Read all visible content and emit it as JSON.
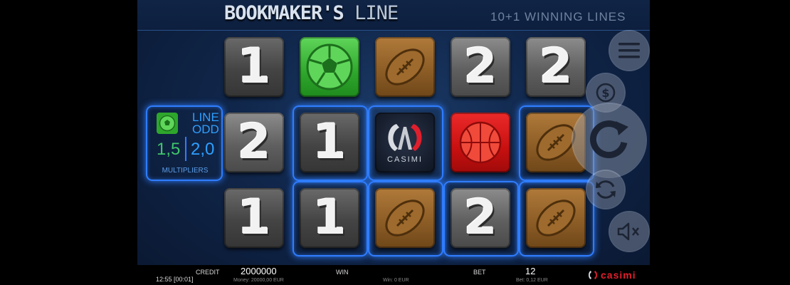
{
  "header": {
    "title_bold": "BOOKMAKER'S",
    "title_light": "LINE",
    "winning_lines": "10+1 WINNING LINES"
  },
  "multipliers": {
    "line_label": "LINE",
    "odd_label": "ODD",
    "value_left": "1,5",
    "value_right": "2,0",
    "caption": "MULTIPLIERS"
  },
  "reels": {
    "row1": [
      "1",
      "soccer",
      "football",
      "2",
      "2"
    ],
    "row2": [
      "2",
      "1",
      "casimi",
      "basketball",
      "football"
    ],
    "row3": [
      "1",
      "1",
      "football",
      "2",
      "football"
    ]
  },
  "logo": {
    "text": "CASIMI"
  },
  "bottom_bar": {
    "time": "12:55 [00:01]",
    "credit_label": "CREDIT",
    "credit_value": "2000000",
    "money": "Money: 20000,00 EUR",
    "win_label": "WIN",
    "win_sub": "Win: 0 EUR",
    "bet_label": "BET",
    "bet_value": "12",
    "bet_sub": "Bet: 0,12 EUR",
    "brand": "casimi"
  },
  "colors": {
    "highlight": "#2f7dff",
    "bg": "#10264a"
  },
  "icons": {
    "menu": "menu-icon",
    "coin": "dollar-coin-icon",
    "spin": "spin-icon",
    "autoplay": "autoplay-icon",
    "sound": "sound-mute-icon"
  }
}
